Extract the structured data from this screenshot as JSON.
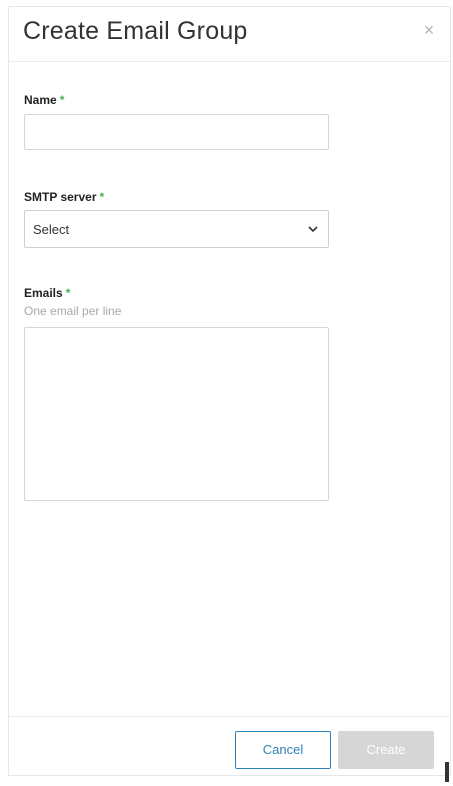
{
  "dialog": {
    "title": "Create Email Group",
    "close_symbol": "×",
    "close_icon": "close-icon"
  },
  "form": {
    "name": {
      "label": "Name",
      "required_mark": "*",
      "value": ""
    },
    "smtp_server": {
      "label": "SMTP server",
      "required_mark": "*",
      "selected": "Select",
      "chevron_icon": "chevron-down-icon"
    },
    "emails": {
      "label": "Emails",
      "required_mark": "*",
      "hint": "One email per line",
      "value": ""
    }
  },
  "footer": {
    "cancel_label": "Cancel",
    "create_label": "Create"
  },
  "colors": {
    "required": "#4caf50",
    "primary": "#2f82b8",
    "disabled_button": "#d6d6d6"
  }
}
